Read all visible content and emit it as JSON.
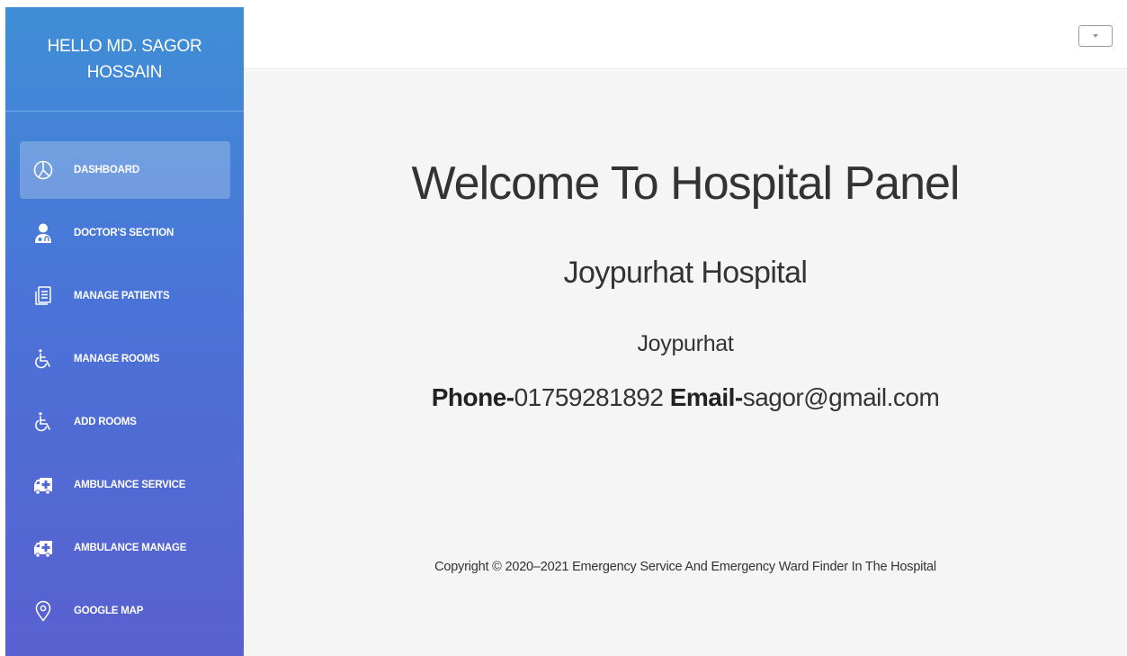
{
  "sidebar": {
    "greeting": "HELLO MD. SAGOR HOSSAIN",
    "items": [
      {
        "label": "DASHBOARD",
        "icon": "pie-chart-icon",
        "active": true
      },
      {
        "label": "DOCTOR'S SECTION",
        "icon": "doctor-icon"
      },
      {
        "label": "MANAGE PATIENTS",
        "icon": "document-list-icon"
      },
      {
        "label": "MANAGE ROOMS",
        "icon": "wheelchair-icon"
      },
      {
        "label": "ADD ROOMS",
        "icon": "wheelchair-icon"
      },
      {
        "label": "AMBULANCE SERVICE",
        "icon": "ambulance-icon"
      },
      {
        "label": "AMBULANCE MANAGE",
        "icon": "ambulance-icon"
      },
      {
        "label": "GOOGLE MAP",
        "icon": "map-pin-icon"
      }
    ]
  },
  "topbar": {
    "dropdown_icon": "caret-down-icon"
  },
  "main": {
    "welcome_title": "Welcome To Hospital Panel",
    "hospital_name": "Joypurhat Hospital",
    "location": "Joypurhat",
    "phone_label": "Phone-",
    "phone_value": "01759281892",
    "email_label": "Email-",
    "email_value": "sagor@gmail.com",
    "copyright": "Copyright © 2020–2021 Emergency Service And Emergency Ward Finder In The Hospital"
  },
  "colors": {
    "sidebar_top": "#3f8fd6",
    "sidebar_bottom": "#5960cf",
    "main_bg": "#f5f5f5",
    "text": "#333333"
  }
}
